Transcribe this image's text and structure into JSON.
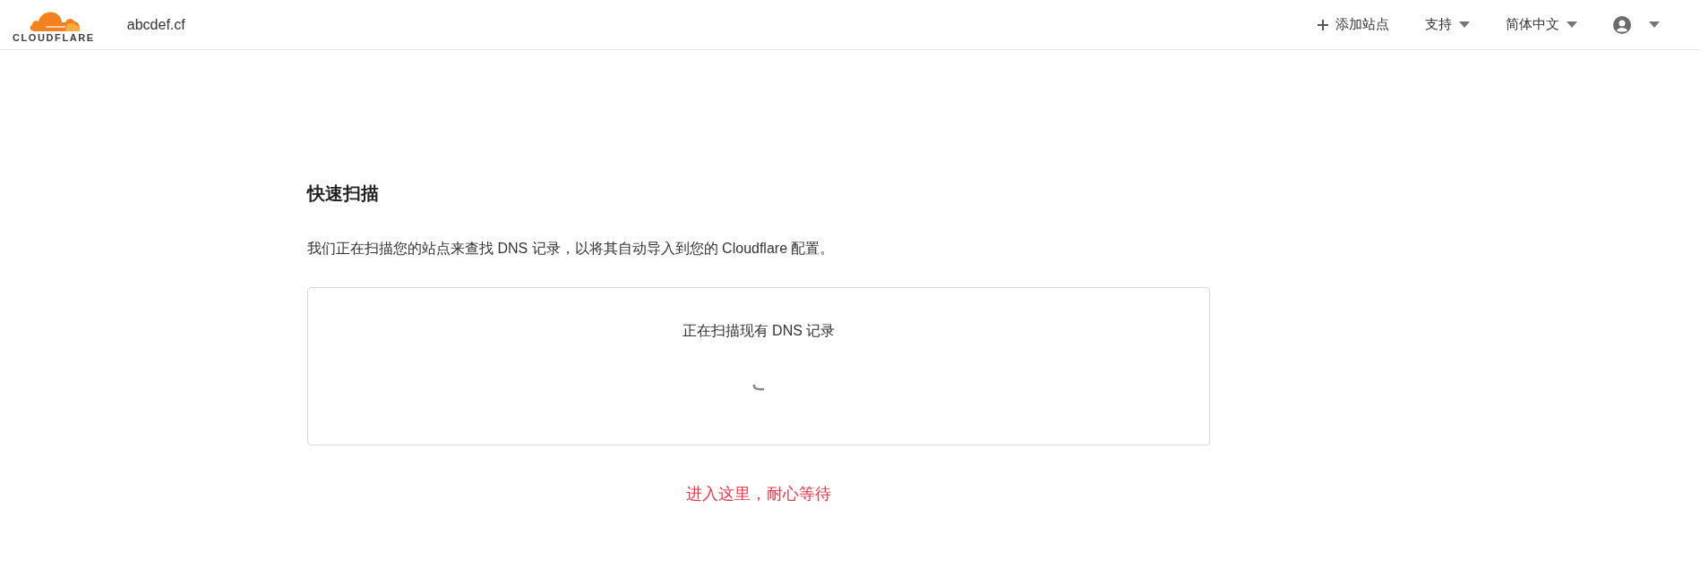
{
  "header": {
    "logo": {
      "wordmark": "CLOUDFLARE"
    },
    "site": "abcdef.cf",
    "nav": [
      {
        "kind": "add",
        "label": "添加站点"
      },
      {
        "kind": "menu",
        "label": "支持"
      },
      {
        "kind": "menu",
        "label": "简体中文"
      },
      {
        "kind": "account"
      }
    ]
  },
  "main": {
    "title": "快速扫描",
    "description": "我们正在扫描您的站点来查找 DNS 记录，以将其自动导入到您的 Cloudflare 配置。",
    "scan_card": {
      "status": "正在扫描现有 DNS 记录"
    },
    "annotation": "进入这里，耐心等待"
  }
}
